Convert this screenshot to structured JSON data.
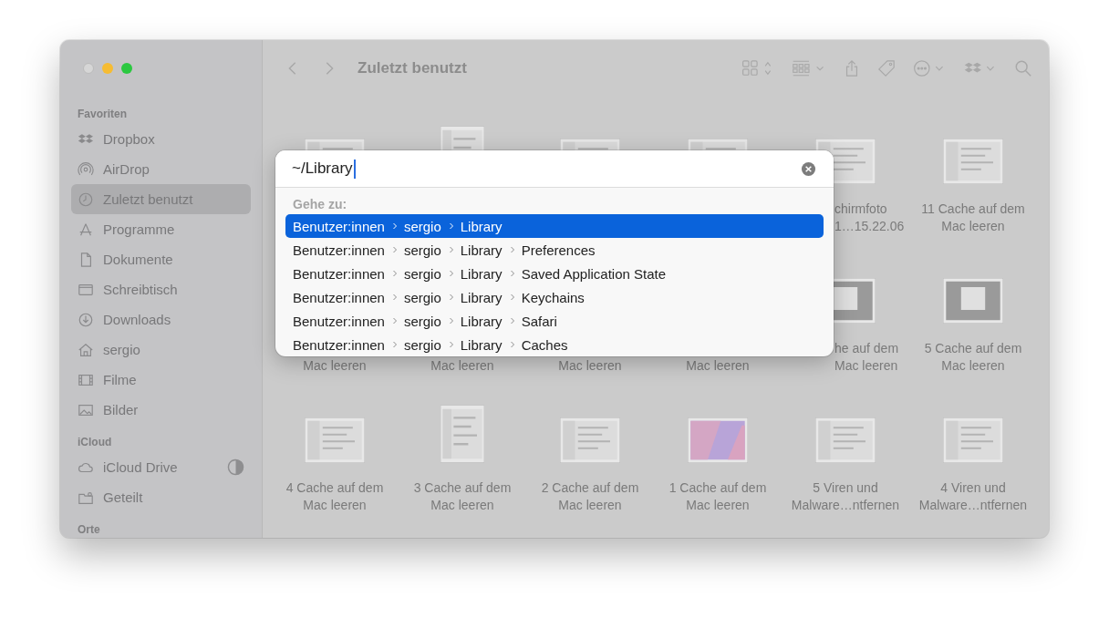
{
  "window": {
    "title": "Zuletzt benutzt"
  },
  "sidebar": {
    "sections": [
      {
        "header": "Favoriten",
        "items": [
          {
            "label": "Dropbox",
            "selected": false
          },
          {
            "label": "AirDrop",
            "selected": false
          },
          {
            "label": "Zuletzt benutzt",
            "selected": true
          },
          {
            "label": "Programme",
            "selected": false
          },
          {
            "label": "Dokumente",
            "selected": false
          },
          {
            "label": "Schreibtisch",
            "selected": false
          },
          {
            "label": "Downloads",
            "selected": false
          },
          {
            "label": "sergio",
            "selected": false
          },
          {
            "label": "Filme",
            "selected": false
          },
          {
            "label": "Bilder",
            "selected": false
          }
        ]
      },
      {
        "header": "iCloud",
        "items": [
          {
            "label": "iCloud Drive",
            "selected": false,
            "syncing": true
          },
          {
            "label": "Geteilt",
            "selected": false
          }
        ]
      },
      {
        "header": "Orte"
      }
    ]
  },
  "files": [
    {
      "kind": "picture"
    },
    {
      "kind": "picture"
    },
    {
      "kind": "picture"
    },
    {
      "kind": "picture"
    },
    {
      "kind": "picture",
      "lines": [
        "chirmfoto",
        "1…15.22.06"
      ]
    },
    {
      "kind": "picture",
      "lines": [
        "11 Cache auf dem",
        "Mac leeren"
      ]
    },
    {
      "lines": [
        "Mac leeren"
      ]
    },
    {
      "lines": [
        "Mac leeren"
      ]
    },
    {
      "lines": [
        "Mac leeren"
      ]
    },
    {
      "lines": [
        "Mac leeren"
      ]
    },
    {
      "kind": "picture",
      "lines": [
        "he auf dem",
        "Mac leeren"
      ]
    },
    {
      "kind": "picture",
      "lines": [
        "5 Cache auf dem",
        "Mac leeren"
      ]
    },
    {
      "kind": "picture",
      "lines": [
        "4 Cache auf dem",
        "Mac leeren"
      ]
    },
    {
      "kind": "picture",
      "lines": [
        "3 Cache auf dem",
        "Mac leeren"
      ]
    },
    {
      "kind": "picture",
      "lines": [
        "2 Cache auf dem",
        "Mac leeren"
      ]
    },
    {
      "kind": "picture",
      "lines": [
        "1 Cache auf dem",
        "Mac leeren"
      ]
    },
    {
      "kind": "picture",
      "lines": [
        "5 Viren und",
        "Malware…ntfernen"
      ]
    },
    {
      "kind": "picture",
      "lines": [
        "4 Viren und",
        "Malware…ntfernen"
      ]
    }
  ],
  "goto_dialog": {
    "value": "~/Library",
    "section": "Gehe zu:",
    "results": [
      {
        "segments": [
          "Benutzer:innen",
          "sergio",
          "Library"
        ],
        "selected": true
      },
      {
        "segments": [
          "Benutzer:innen",
          "sergio",
          "Library",
          "Preferences"
        ],
        "selected": false
      },
      {
        "segments": [
          "Benutzer:innen",
          "sergio",
          "Library",
          "Saved Application State"
        ],
        "selected": false
      },
      {
        "segments": [
          "Benutzer:innen",
          "sergio",
          "Library",
          "Keychains"
        ],
        "selected": false
      },
      {
        "segments": [
          "Benutzer:innen",
          "sergio",
          "Library",
          "Safari"
        ],
        "selected": false
      },
      {
        "segments": [
          "Benutzer:innen",
          "sergio",
          "Library",
          "Caches"
        ],
        "selected": false
      }
    ]
  }
}
